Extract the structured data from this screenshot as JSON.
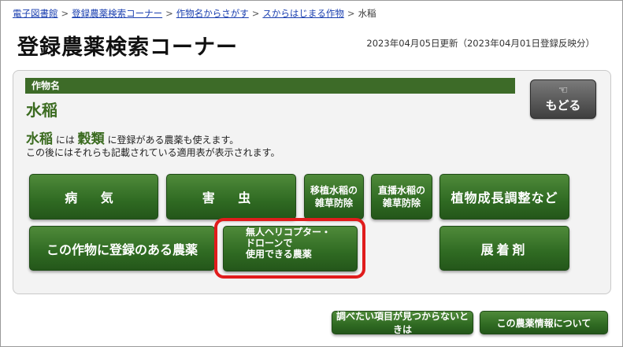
{
  "breadcrumb": {
    "items": [
      "電子図書館",
      "登録農薬検索コーナー",
      "作物名からさがす",
      "スからはじまる作物"
    ],
    "current": "水稲",
    "separator": ">"
  },
  "header": {
    "title": "登録農薬検索コーナー",
    "updated": "2023年04月05日更新（2023年04月01日登録反映分）"
  },
  "crop": {
    "label": "作物名",
    "name": "水稲"
  },
  "back_button": {
    "label": "もどる",
    "icon": "pointing-hand-icon"
  },
  "notes": {
    "crop": "水稲",
    "mid1": " には ",
    "group": "穀類",
    "mid2": " に登録がある農薬も使えます。",
    "line2": "この後にはそれらも記載されている適用表が表示されます。"
  },
  "buttons": {
    "disease": "病 気",
    "pest": "害 虫",
    "transplant_line1": "移植水稲の",
    "transplant_line2": "雑草防除",
    "direct_line1": "直播水稲の",
    "direct_line2": "雑草防除",
    "growth": "植物成長調整など",
    "registered": "この作物に登録のある農薬",
    "drone_line1": "無人ヘリコプター・",
    "drone_line2": "ドローンで",
    "drone_line3": "使用できる農薬",
    "spreader": "展着剤"
  },
  "footer": {
    "not_found": "調べたい項目が見つからないときは",
    "about": "この農薬情報について"
  },
  "colors": {
    "accent_green": "#3d6b28",
    "button_green": "#2f6a22",
    "highlight_red": "#e01c1c",
    "link_blue": "#1a3fb0"
  }
}
